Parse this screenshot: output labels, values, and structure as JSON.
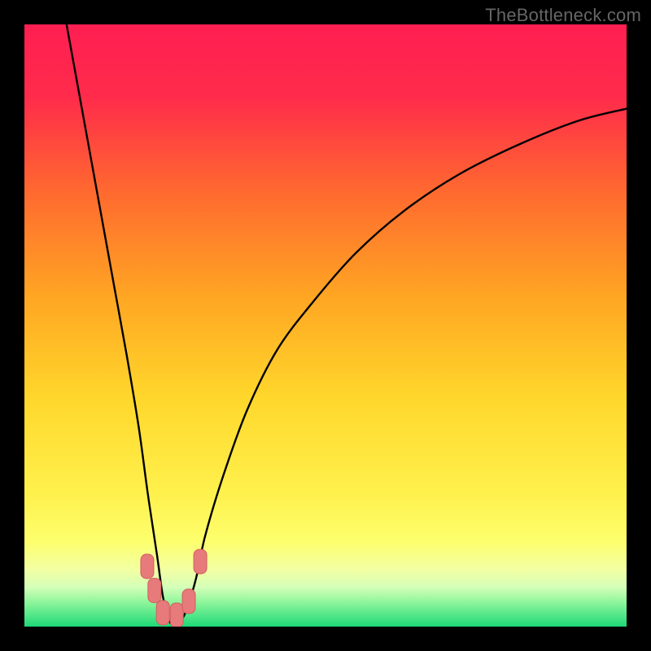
{
  "watermark": "TheBottleneck.com",
  "colors": {
    "black": "#000000",
    "curve": "#000000",
    "marker_fill": "#e77a7a",
    "marker_stroke": "#d45f5f",
    "gradient_stops": [
      {
        "offset": 0.0,
        "color": "#ff1f52"
      },
      {
        "offset": 0.12,
        "color": "#ff2b4b"
      },
      {
        "offset": 0.28,
        "color": "#ff6a2f"
      },
      {
        "offset": 0.45,
        "color": "#ffa523"
      },
      {
        "offset": 0.62,
        "color": "#ffd72b"
      },
      {
        "offset": 0.78,
        "color": "#fff14d"
      },
      {
        "offset": 0.86,
        "color": "#fdff6e"
      },
      {
        "offset": 0.905,
        "color": "#f3ffa3"
      },
      {
        "offset": 0.935,
        "color": "#d4ffb8"
      },
      {
        "offset": 0.96,
        "color": "#8df59b"
      },
      {
        "offset": 1.0,
        "color": "#1ed977"
      }
    ]
  },
  "chart_data": {
    "type": "line",
    "title": "",
    "xlabel": "",
    "ylabel": "",
    "xlim": [
      0,
      100
    ],
    "ylim": [
      0,
      100
    ],
    "note": "V-shaped bottleneck curve. x is relative horizontal position (%), y is bottleneck percentage (top=100, bottom=0). Minimum near x≈24 at y≈0.",
    "series": [
      {
        "name": "bottleneck-curve",
        "x": [
          7,
          9,
          11,
          13,
          15,
          17,
          19,
          20.5,
          22,
          23,
          24,
          25,
          26,
          27,
          28.5,
          30,
          33,
          37,
          42,
          48,
          55,
          63,
          72,
          82,
          92,
          100
        ],
        "y": [
          100,
          89,
          78,
          67,
          56,
          45,
          33,
          22,
          12,
          5,
          1,
          0.5,
          1,
          3,
          8,
          15,
          25,
          36,
          46,
          54,
          62,
          69,
          75,
          80,
          84,
          86
        ]
      }
    ],
    "markers": {
      "name": "sweet-spot-markers",
      "points": [
        {
          "x": 20.4,
          "y": 10.0
        },
        {
          "x": 21.6,
          "y": 6.0
        },
        {
          "x": 23.0,
          "y": 2.3
        },
        {
          "x": 25.3,
          "y": 1.9
        },
        {
          "x": 27.3,
          "y": 4.2
        },
        {
          "x": 29.2,
          "y": 10.8
        }
      ]
    }
  }
}
